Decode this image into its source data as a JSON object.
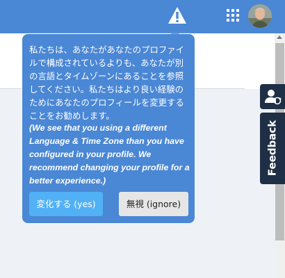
{
  "topbar": {
    "warning_icon": "warning-triangle-icon",
    "apps_icon": "apps-grid-icon",
    "avatar": "user-avatar"
  },
  "side_actions": {
    "user_switch_icon": "user-switch-icon",
    "feedback_label": "Feedback"
  },
  "popup": {
    "message_jp": "私たちは、あなたがあなたのプロファイルで構成されているよりも、あなたが別の言語とタイムゾーンにあることを参照してください。私たちはより良い経験のためにあなたのプロフィールを変更することをお勧めします。",
    "message_en": "(We see that you using a different Language & Time Zone than you have configured in your profile. We recommend changing your profile for a better experience.)",
    "yes_label": "変化する (yes)",
    "ignore_label": "無視 (ignore)"
  },
  "colors": {
    "primary": "#4a87d5",
    "button_yes": "#52b1f5",
    "button_ignore": "#e6e6e6",
    "side_tab": "#1f2f45"
  }
}
